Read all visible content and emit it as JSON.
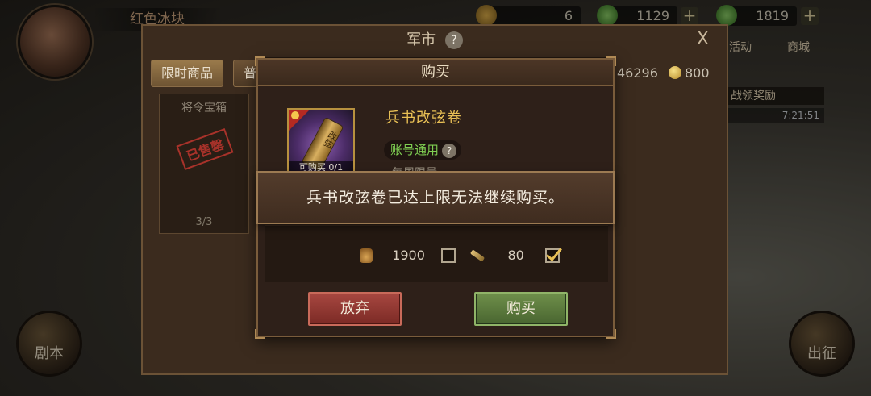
{
  "hud": {
    "player_name": "红色冰块",
    "resources": [
      {
        "value": "6"
      },
      {
        "value": "1129"
      },
      {
        "value": "1819"
      }
    ],
    "plus": "+",
    "side_left": "剧本",
    "side_right": "出征",
    "right_menu": [
      "活动",
      "商城"
    ],
    "right_strip": "战领奖励",
    "right_timer": "7:21:51"
  },
  "market": {
    "title": "军市",
    "help": "?",
    "close": "X",
    "tabs": [
      "限时商品",
      "普"
    ],
    "currency_a": "46296",
    "currency_b": "800",
    "bg_card_title": "将令宝箱",
    "bg_card_stamp": "已售罄",
    "bg_card_count": "3/3"
  },
  "dialog": {
    "title": "购买",
    "item_name": "兵书改弦卷",
    "item_scroll_text": "改弦",
    "item_buy_limit": "可购买 0/1",
    "account_tag": "账号通用",
    "account_help": "?",
    "weekly_limit": "每周限量",
    "price_money": "1900",
    "price_blade": "80",
    "abandon_label": "放弃",
    "buy_label": "购买"
  },
  "toast": {
    "message": "兵书改弦卷已达上限无法继续购买。"
  },
  "colors": {
    "accent_gold": "#e8bf55",
    "green_text": "#7fcf52",
    "abandon_red": "#7b2a25",
    "buy_green": "#496530"
  }
}
